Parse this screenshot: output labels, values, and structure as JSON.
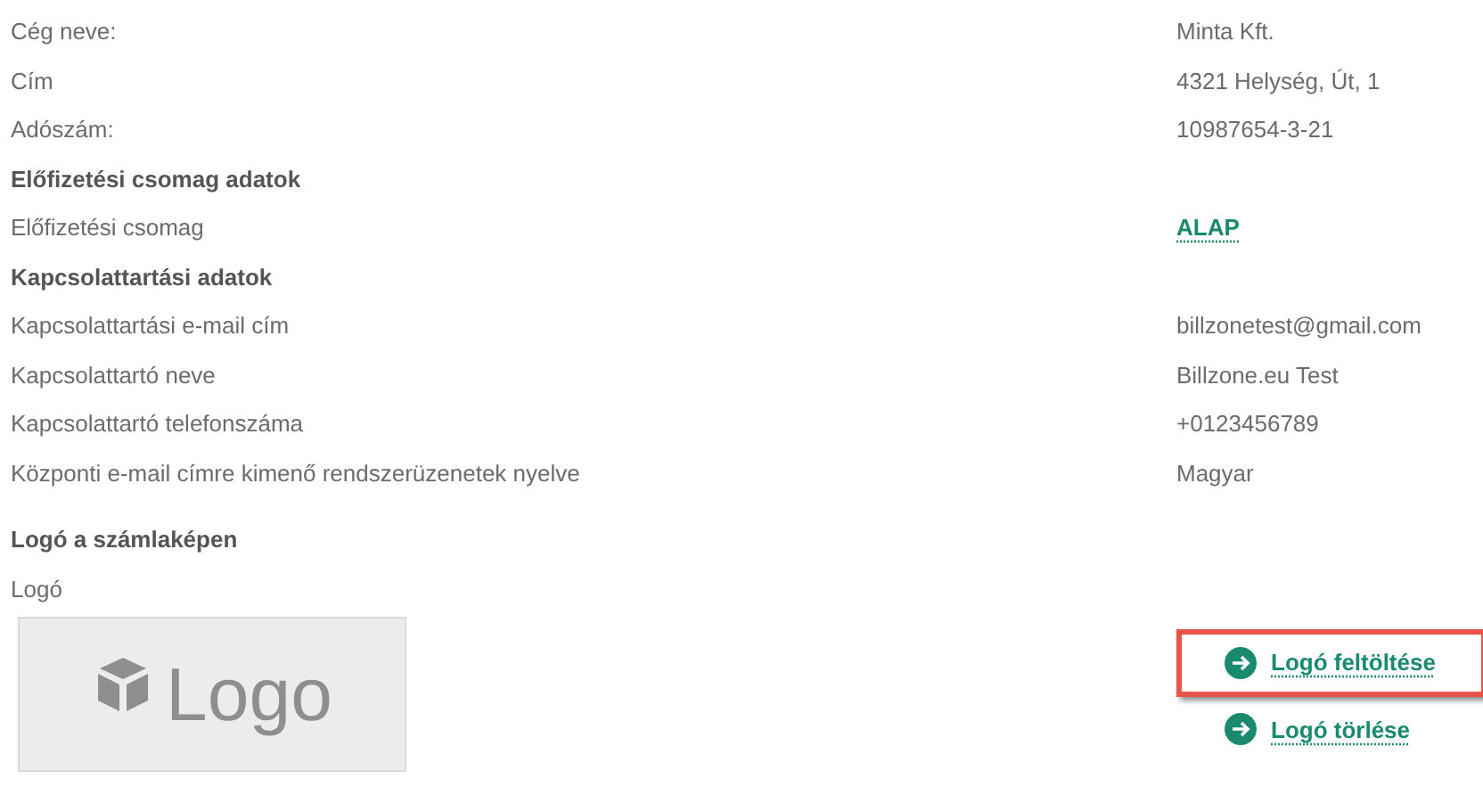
{
  "rows": [
    {
      "kind": "field",
      "label": "Cég neve:",
      "value": "Minta Kft."
    },
    {
      "kind": "field",
      "label": "Cím",
      "value": "4321 Helység, Út, 1"
    },
    {
      "kind": "field",
      "label": "Adószám:",
      "value": "10987654-3-21"
    },
    {
      "kind": "heading",
      "label": "Előfizetési csomag adatok"
    },
    {
      "kind": "link",
      "label": "Előfizetési csomag",
      "value": "ALAP"
    },
    {
      "kind": "heading",
      "label": "Kapcsolattartási adatok"
    },
    {
      "kind": "field",
      "label": "Kapcsolattartási e-mail cím",
      "value": "billzonetest@gmail.com"
    },
    {
      "kind": "field",
      "label": "Kapcsolattartó neve",
      "value": "Billzone.eu Test"
    },
    {
      "kind": "field",
      "label": "Kapcsolattartó telefonszáma",
      "value": "+0123456789"
    },
    {
      "kind": "field",
      "label": "Központi e-mail címre kimenő rendszerüzenetek nyelve",
      "value": "Magyar"
    }
  ],
  "logo_section": {
    "heading": "Logó a számlaképen",
    "label": "Logó",
    "placeholder_text": "Logo",
    "actions": [
      {
        "label": "Logó feltöltése",
        "highlighted": true
      },
      {
        "label": "Logó törlése",
        "highlighted": false
      }
    ]
  }
}
